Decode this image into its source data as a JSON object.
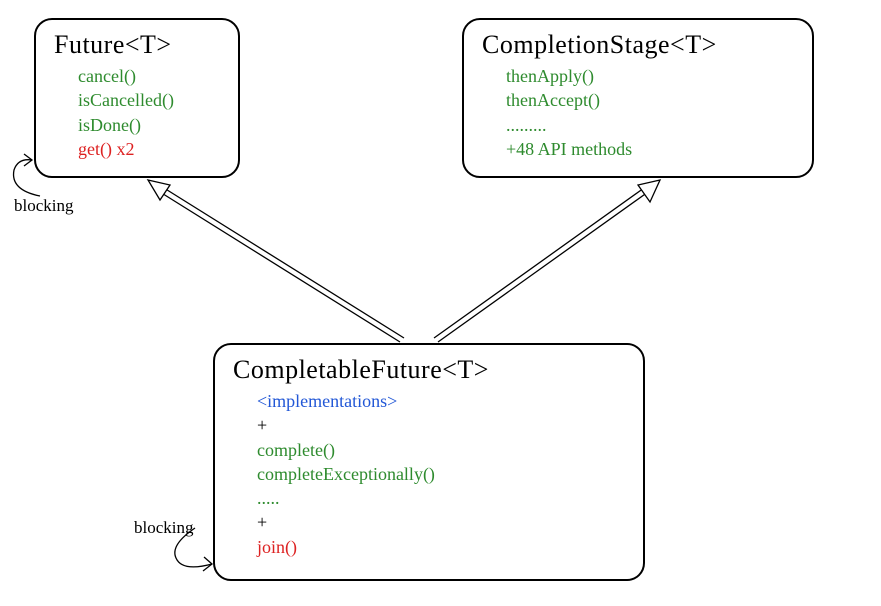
{
  "boxes": {
    "future": {
      "title": "Future<T>",
      "methods": [
        {
          "text": "cancel()",
          "cls": "m-green"
        },
        {
          "text": "isCancelled()",
          "cls": "m-green"
        },
        {
          "text": "isDone()",
          "cls": "m-green"
        },
        {
          "text": "get() x2",
          "cls": "m-red"
        }
      ]
    },
    "completionStage": {
      "title": "CompletionStage<T>",
      "methods": [
        {
          "text": "thenApply()",
          "cls": "m-green"
        },
        {
          "text": "thenAccept()",
          "cls": "m-green"
        },
        {
          "text": ".........",
          "cls": "m-green"
        },
        {
          "text": "+48 API methods",
          "cls": "m-green"
        }
      ]
    },
    "completableFuture": {
      "title": "CompletableFuture<T>",
      "methods": [
        {
          "text": "<implementations>",
          "cls": "m-blue"
        },
        {
          "text": "+",
          "cls": "m-black"
        },
        {
          "text": "complete()",
          "cls": "m-green"
        },
        {
          "text": "completeExceptionally()",
          "cls": "m-green"
        },
        {
          "text": ".....",
          "cls": "m-green"
        },
        {
          "text": "+",
          "cls": "m-black"
        },
        {
          "text": "join()",
          "cls": "m-red"
        }
      ]
    }
  },
  "annotations": {
    "blocking1": "blocking",
    "blocking2": "blocking"
  }
}
